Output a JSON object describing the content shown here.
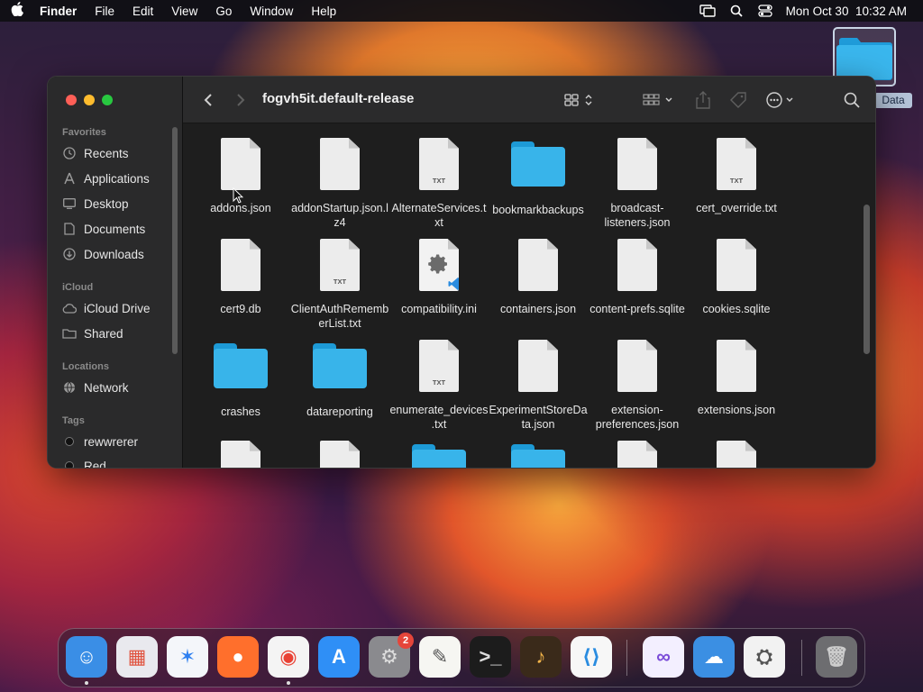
{
  "menubar": {
    "app_name": "Finder",
    "items": [
      "File",
      "Edit",
      "View",
      "Go",
      "Window",
      "Help"
    ],
    "clock": "Mon Oct 30  10:32 AM"
  },
  "desktop": {
    "folder_label": "Data"
  },
  "window": {
    "title": "fogvh5it.default-release",
    "sidebar": {
      "favorites_label": "Favorites",
      "favorites": [
        {
          "label": "Recents",
          "icon": "clock-icon"
        },
        {
          "label": "Applications",
          "icon": "applications-icon"
        },
        {
          "label": "Desktop",
          "icon": "desktop-icon"
        },
        {
          "label": "Documents",
          "icon": "document-icon"
        },
        {
          "label": "Downloads",
          "icon": "download-icon"
        }
      ],
      "icloud_label": "iCloud",
      "icloud": [
        {
          "label": "iCloud Drive",
          "icon": "cloud-icon"
        },
        {
          "label": "Shared",
          "icon": "shared-folder-icon"
        }
      ],
      "locations_label": "Locations",
      "locations": [
        {
          "label": "Network",
          "icon": "globe-icon"
        }
      ],
      "tags_label": "Tags",
      "tags": [
        {
          "label": "rewwrerer",
          "color": "#111111"
        },
        {
          "label": "Red",
          "color": "#111111"
        }
      ]
    },
    "files": [
      {
        "name": "addons.json",
        "kind": "doc",
        "ext": ""
      },
      {
        "name": "addonStartup.json.lz4",
        "kind": "doc",
        "ext": ""
      },
      {
        "name": "AlternateServices.txt",
        "kind": "doc",
        "ext": "TXT"
      },
      {
        "name": "bookmarkbackups",
        "kind": "folder",
        "ext": ""
      },
      {
        "name": "broadcast-listeners.json",
        "kind": "doc",
        "ext": ""
      },
      {
        "name": "cert_override.txt",
        "kind": "doc",
        "ext": "TXT"
      },
      {
        "name": "cert9.db",
        "kind": "doc",
        "ext": ""
      },
      {
        "name": "ClientAuthRememberList.txt",
        "kind": "doc",
        "ext": "TXT"
      },
      {
        "name": "compatibility.ini",
        "kind": "gear",
        "ext": ""
      },
      {
        "name": "containers.json",
        "kind": "doc",
        "ext": ""
      },
      {
        "name": "content-prefs.sqlite",
        "kind": "doc",
        "ext": ""
      },
      {
        "name": "cookies.sqlite",
        "kind": "doc",
        "ext": ""
      },
      {
        "name": "crashes",
        "kind": "folder",
        "ext": ""
      },
      {
        "name": "datareporting",
        "kind": "folder",
        "ext": ""
      },
      {
        "name": "enumerate_devices.txt",
        "kind": "doc",
        "ext": "TXT"
      },
      {
        "name": "ExperimentStoreData.json",
        "kind": "doc",
        "ext": ""
      },
      {
        "name": "extension-preferences.json",
        "kind": "doc",
        "ext": ""
      },
      {
        "name": "extensions.json",
        "kind": "doc",
        "ext": ""
      }
    ]
  },
  "dock": {
    "apps": [
      {
        "name": "Finder",
        "color": "#3a8ee6"
      },
      {
        "name": "Launchpad",
        "color": "#e9e9ee"
      },
      {
        "name": "Safari",
        "color": "#f4f6fa"
      },
      {
        "name": "Firefox",
        "color": "#ff6f2c"
      },
      {
        "name": "Chrome",
        "color": "#f4f4f4"
      },
      {
        "name": "App Store",
        "color": "#2f8ff6"
      },
      {
        "name": "System Settings",
        "color": "#8a8a8e",
        "badge": "2"
      },
      {
        "name": "TextEdit",
        "color": "#f6f6f2"
      },
      {
        "name": "Terminal",
        "color": "#1c1c1c"
      },
      {
        "name": "GarageBand",
        "color": "#3a2a1a"
      },
      {
        "name": "Visual Studio Code",
        "color": "#f7f7f7"
      },
      {
        "name": "Visual Studio",
        "color": "#f3efff"
      },
      {
        "name": "Weather",
        "color": "#3b8fe3"
      },
      {
        "name": "System Information",
        "color": "#f2f2f2"
      },
      {
        "name": "Trash",
        "color": "#6d6d70"
      }
    ]
  }
}
